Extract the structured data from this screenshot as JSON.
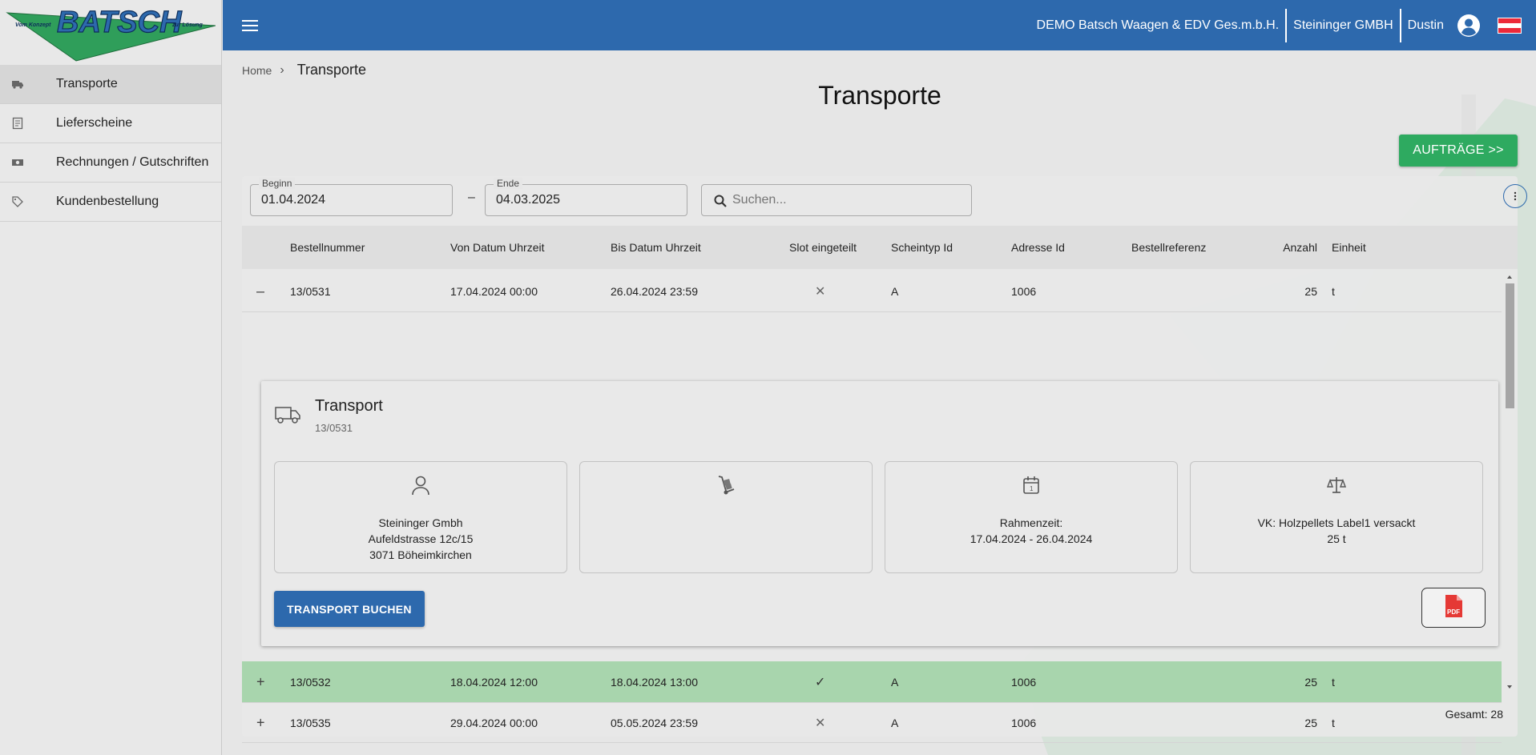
{
  "logo": {
    "text": "BATSCH",
    "tagline_left": "Vom Konzept",
    "tagline_right": "zur Lösung"
  },
  "sidebar": {
    "items": [
      {
        "label": "Transporte",
        "icon": "truck-icon",
        "active": true
      },
      {
        "label": "Lieferscheine",
        "icon": "receipt-icon",
        "active": false
      },
      {
        "label": "Rechnungen / Gutschriften",
        "icon": "money-icon",
        "active": false
      },
      {
        "label": "Kundenbestellung",
        "icon": "tag-icon",
        "active": false
      }
    ]
  },
  "header": {
    "company": "DEMO Batsch Waagen & EDV Ges.m.b.H.",
    "client": "Steininger GMBH",
    "user": "Dustin",
    "color": "#2d69ad"
  },
  "breadcrumb": {
    "home": "Home",
    "current": "Transporte"
  },
  "page": {
    "title": "Transporte",
    "orders_button": "AUFTRÄGE >>"
  },
  "filters": {
    "begin_label": "Beginn",
    "begin_value": "01.04.2024",
    "separator": "–",
    "end_label": "Ende",
    "end_value": "04.03.2025",
    "search_placeholder": "Suchen..."
  },
  "table": {
    "columns": [
      "Bestellnummer",
      "Von Datum Uhrzeit",
      "Bis Datum Uhrzeit",
      "Slot eingeteilt",
      "Scheintyp Id",
      "Adresse Id",
      "Bestellreferenz",
      "Anzahl",
      "Einheit"
    ],
    "rows": [
      {
        "expander": "–",
        "nr": "13/0531",
        "von": "17.04.2024 00:00",
        "bis": "26.04.2024 23:59",
        "slot": "✕",
        "typ": "A",
        "adresse": "1006",
        "ref": "",
        "anzahl": "25",
        "einheit": "t"
      },
      {
        "expander": "+",
        "nr": "13/0532",
        "von": "18.04.2024 12:00",
        "bis": "18.04.2024 13:00",
        "slot": "✓",
        "typ": "A",
        "adresse": "1006",
        "ref": "",
        "anzahl": "25",
        "einheit": "t"
      },
      {
        "expander": "+",
        "nr": "13/0535",
        "von": "29.04.2024 00:00",
        "bis": "05.05.2024 23:59",
        "slot": "✕",
        "typ": "A",
        "adresse": "1006",
        "ref": "",
        "anzahl": "25",
        "einheit": "t"
      }
    ],
    "total": "Gesamt: 28"
  },
  "detail": {
    "title": "Transport",
    "subtitle": "13/0531",
    "customer_line1": "Steininger Gmbh",
    "customer_line2": "Aufeldstrasse 12c/15",
    "customer_line3": "3071 Böheimkirchen",
    "frame_label": "Rahmenzeit:",
    "frame_value": "17.04.2024 - 26.04.2024",
    "product_line1": "VK: Holzpellets Label1 versackt",
    "product_line2": "25 t",
    "book_button": "TRANSPORT BUCHEN",
    "pdf_label": "PDF"
  },
  "colors": {
    "primary": "#2d69ad",
    "accent_green": "#2eaa60",
    "row_highlight": "#a8d5ad",
    "pdf_red": "#e53935"
  }
}
